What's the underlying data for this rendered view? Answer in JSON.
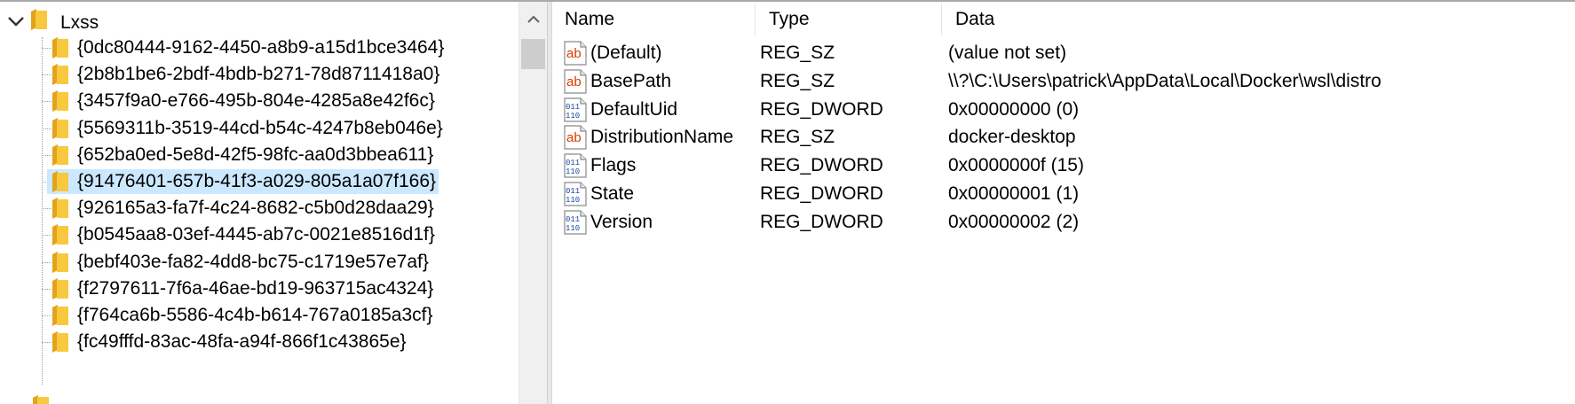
{
  "tree": {
    "root_label": "Lxss",
    "items": [
      {
        "label": "{0dc80444-9162-4450-a8b9-a15d1bce3464}",
        "selected": false
      },
      {
        "label": "{2b8b1be6-2bdf-4bdb-b271-78d8711418a0}",
        "selected": false
      },
      {
        "label": "{3457f9a0-e766-495b-804e-4285a8e42f6c}",
        "selected": false
      },
      {
        "label": "{5569311b-3519-44cd-b54c-4247b8eb046e}",
        "selected": false
      },
      {
        "label": "{652ba0ed-5e8d-42f5-98fc-aa0d3bbea611}",
        "selected": false
      },
      {
        "label": "{91476401-657b-41f3-a029-805a1a07f166}",
        "selected": true
      },
      {
        "label": "{926165a3-fa7f-4c24-8682-c5b0d28daa29}",
        "selected": false
      },
      {
        "label": "{b0545aa8-03ef-4445-ab7c-0021e8516d1f}",
        "selected": false
      },
      {
        "label": "{bebf403e-fa82-4dd8-bc75-c1719e57e7af}",
        "selected": false
      },
      {
        "label": "{f2797611-7f6a-46ae-bd19-963715ac4324}",
        "selected": false
      },
      {
        "label": "{f764ca6b-5586-4c4b-b614-767a0185a3cf}",
        "selected": false
      },
      {
        "label": "{fc49fffd-83ac-48fa-a94f-866f1c43865e}",
        "selected": false
      }
    ]
  },
  "values": {
    "headers": {
      "name": "Name",
      "type": "Type",
      "data": "Data"
    },
    "rows": [
      {
        "icon": "string-value-icon",
        "name": "(Default)",
        "type": "REG_SZ",
        "data": "(value not set)"
      },
      {
        "icon": "string-value-icon",
        "name": "BasePath",
        "type": "REG_SZ",
        "data": "\\\\?\\C:\\Users\\patrick\\AppData\\Local\\Docker\\wsl\\distro"
      },
      {
        "icon": "binary-value-icon",
        "name": "DefaultUid",
        "type": "REG_DWORD",
        "data": "0x00000000 (0)"
      },
      {
        "icon": "string-value-icon",
        "name": "DistributionName",
        "type": "REG_SZ",
        "data": "docker-desktop"
      },
      {
        "icon": "binary-value-icon",
        "name": "Flags",
        "type": "REG_DWORD",
        "data": "0x0000000f (15)"
      },
      {
        "icon": "binary-value-icon",
        "name": "State",
        "type": "REG_DWORD",
        "data": "0x00000001 (1)"
      },
      {
        "icon": "binary-value-icon",
        "name": "Version",
        "type": "REG_DWORD",
        "data": "0x00000002 (2)"
      }
    ]
  },
  "colors": {
    "selection": "#cce8ff",
    "folder": "#f8c93e",
    "string_icon_red": "#d83b01",
    "binary_icon_blue": "#1a4aa8"
  }
}
